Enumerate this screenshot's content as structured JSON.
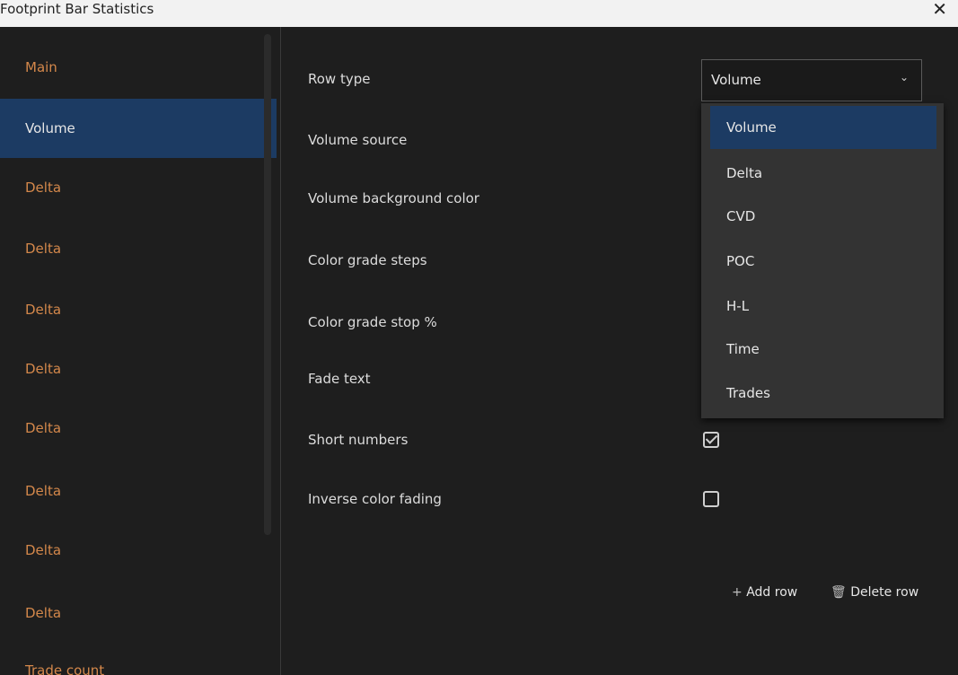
{
  "window": {
    "title": "Footprint Bar Statistics",
    "close_icon": "close-icon"
  },
  "sidebar": {
    "items": [
      {
        "label": "Main",
        "active": false
      },
      {
        "label": "Volume",
        "active": true
      },
      {
        "label": "Delta",
        "active": false
      },
      {
        "label": "Delta",
        "active": false
      },
      {
        "label": "Delta",
        "active": false
      },
      {
        "label": "Delta",
        "active": false
      },
      {
        "label": "Delta",
        "active": false
      },
      {
        "label": "Delta",
        "active": false
      },
      {
        "label": "Delta",
        "active": false
      },
      {
        "label": "Delta",
        "active": false
      },
      {
        "label": "Trade count",
        "active": false
      }
    ]
  },
  "fields": {
    "row_type": "Row type",
    "volume_source": "Volume source",
    "volume_bg_color": "Volume background color",
    "color_grade_steps": "Color grade steps",
    "color_grade_stop": "Color grade stop %",
    "fade_text": "Fade text",
    "short_numbers": "Short numbers",
    "inverse_color_fading": "Inverse color fading"
  },
  "row_type_select": {
    "value": "Volume",
    "options": [
      "Volume",
      "Delta",
      "CVD",
      "POC",
      "H-L",
      "Time",
      "Trades"
    ],
    "selected_index": 0
  },
  "checkboxes": {
    "short_numbers": true,
    "inverse_color_fading": false
  },
  "actions": {
    "add_row": "Add row",
    "add_icon": "+",
    "delete_row": "Delete row",
    "delete_icon": "🗑"
  },
  "colors": {
    "accent": "#1c3b63",
    "sidebar_text": "#d4884b",
    "background": "#1e1e1e"
  }
}
